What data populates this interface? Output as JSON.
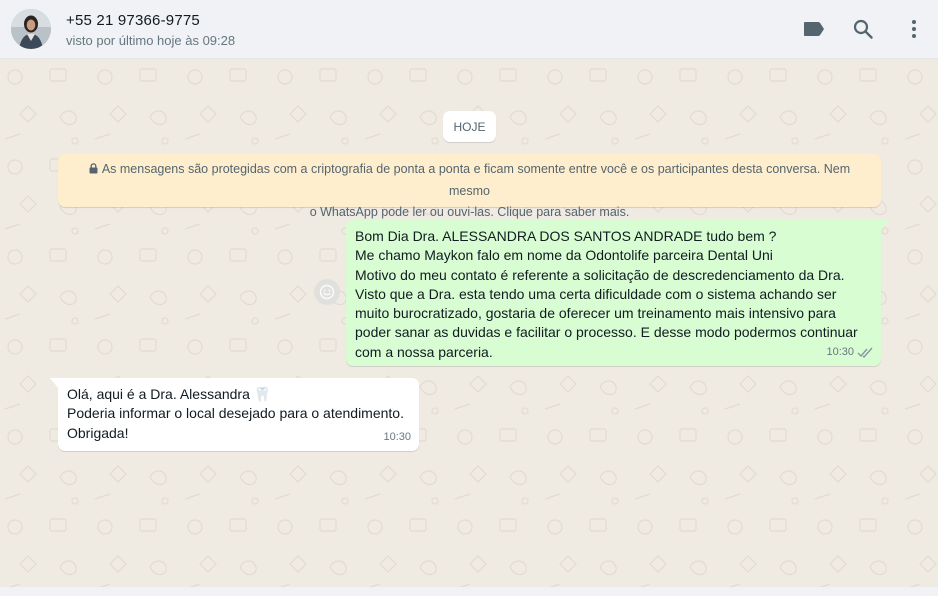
{
  "header": {
    "contact_name": "+55 21 97366-9775",
    "last_seen": "visto por último hoje às 09:28",
    "icons": [
      "label-icon",
      "search-icon",
      "menu-dots-icon"
    ]
  },
  "chat": {
    "date_chip": "HOJE",
    "encryption_notice": {
      "line1": "As mensagens são protegidas com a criptografia de ponta a ponta e ficam somente entre você e os participantes desta conversa. Nem mesmo",
      "line2": "o WhatsApp pode ler ou ouvi-las. Clique para saber mais."
    },
    "messages": [
      {
        "direction": "outgoing",
        "lines": [
          "Bom Dia Dra. ALESSANDRA DOS SANTOS ANDRADE tudo bem ?",
          "Me chamo Maykon falo em nome da Odontolife parceira Dental Uni",
          "Motivo do meu contato é referente a solicitação de descredenciamento da Dra.",
          "Visto que a Dra. esta tendo uma certa dificuldade com o sistema achando ser",
          "muito burocratizado, gostaria de oferecer um treinamento mais intensivo para",
          "poder sanar as duvidas e facilitar o processo. E desse modo podermos continuar",
          "com a nossa parceria."
        ],
        "time": "10:30",
        "status": "read"
      },
      {
        "direction": "incoming",
        "lines": [
          "Olá,  aqui é a Dra. Alessandra 🦷",
          "Poderia informar o local desejado para o atendimento.",
          "Obrigada!"
        ],
        "time": "10:30"
      }
    ]
  },
  "colors": {
    "header_bg": "#f0f2f5",
    "chat_bg": "#efeae2",
    "outgoing_bubble": "#d9fdd3",
    "incoming_bubble": "#ffffff",
    "notice_bg": "#ffeecd",
    "icon_gray": "#54656f"
  }
}
